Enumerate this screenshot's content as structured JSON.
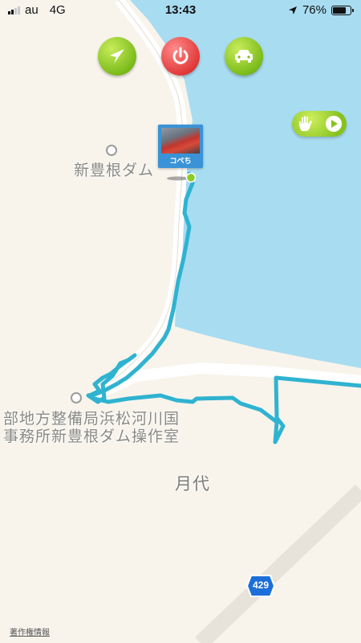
{
  "status_bar": {
    "carrier": "au",
    "network": "4G",
    "time": "13:43",
    "battery": "76%",
    "battery_level": 0.76,
    "signal_bars_filled": 2
  },
  "toolbar": {
    "navigate_icon": "navigation-arrow-icon",
    "power_icon": "power-icon",
    "car_icon": "car-icon"
  },
  "hand_button": {
    "icons": [
      "hand-icon",
      "play-icon"
    ]
  },
  "map": {
    "labels": {
      "dam": "新豊根ダム",
      "office_line1": "部地方整備局浜松河川国",
      "office_line2": "事務所新豊根ダム操作室",
      "area": "月代",
      "route_number": "429"
    },
    "colors": {
      "water": "#a8dcf1",
      "land": "#f8f4ec",
      "road": "#ffffff",
      "track": "#2fb3d0"
    }
  },
  "marker": {
    "name": "コペち"
  },
  "legal": "著作権情報"
}
